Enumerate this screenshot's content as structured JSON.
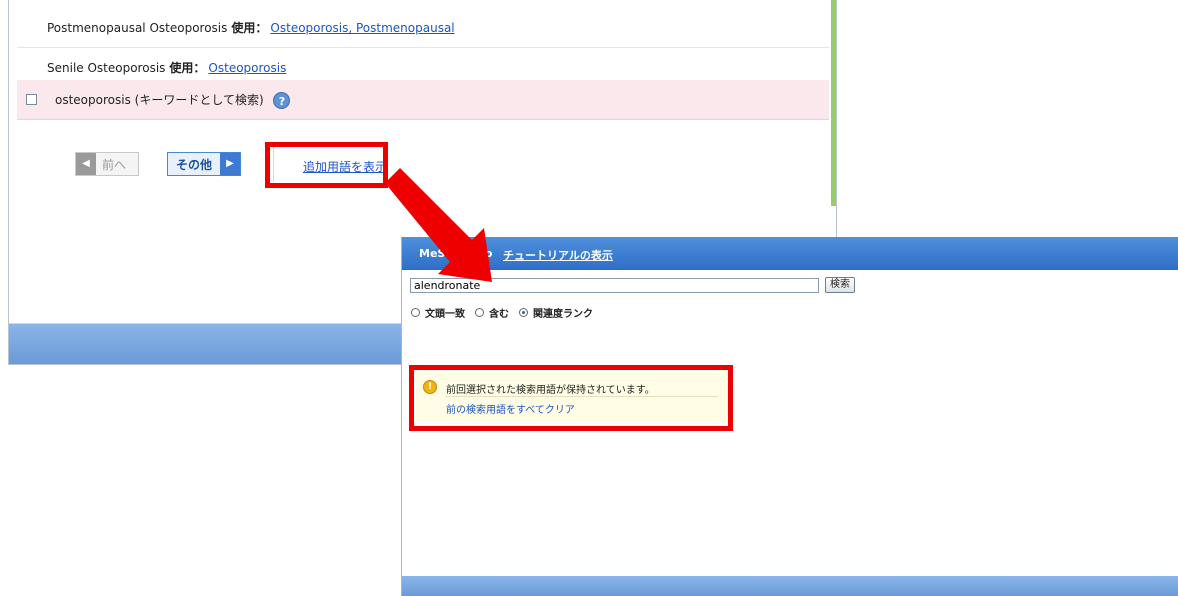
{
  "term_list": {
    "rows": [
      {
        "term": "Postmenopausal Osteoporosis",
        "use_label": "使用：",
        "link": "Osteoporosis, Postmenopausal"
      },
      {
        "term": "Senile Osteoporosis",
        "use_label": "使用：",
        "link": "Osteoporosis"
      }
    ],
    "keyword_row": {
      "text": "osteoporosis (キーワードとして検索)",
      "help_icon": "question-icon",
      "checked": false
    },
    "pager": {
      "prev_label": "前へ",
      "next_label": "その他"
    },
    "add_terms_link": "追加用語を表示"
  },
  "search_panel": {
    "title": "MeSH Lingo",
    "tutorial_link": "チュートリアルの表示",
    "query": "alendronate",
    "search_button": "検索",
    "match_options": [
      {
        "label": "文頭一致",
        "selected": false
      },
      {
        "label": "含む",
        "selected": false
      },
      {
        "label": "関連度ランク",
        "selected": true
      }
    ],
    "notice": {
      "message": "前回選択された検索用語が保持されています。",
      "clear_link": "前の検索用語をすべてクリア",
      "icon": "warning-icon"
    }
  },
  "colors": {
    "highlight_red": "#ee0000",
    "header_blue": "#2f6fc6",
    "link_blue": "#1a55c6",
    "keyword_row_pink": "#fbe8ec",
    "notice_bg": "#fffde6"
  }
}
